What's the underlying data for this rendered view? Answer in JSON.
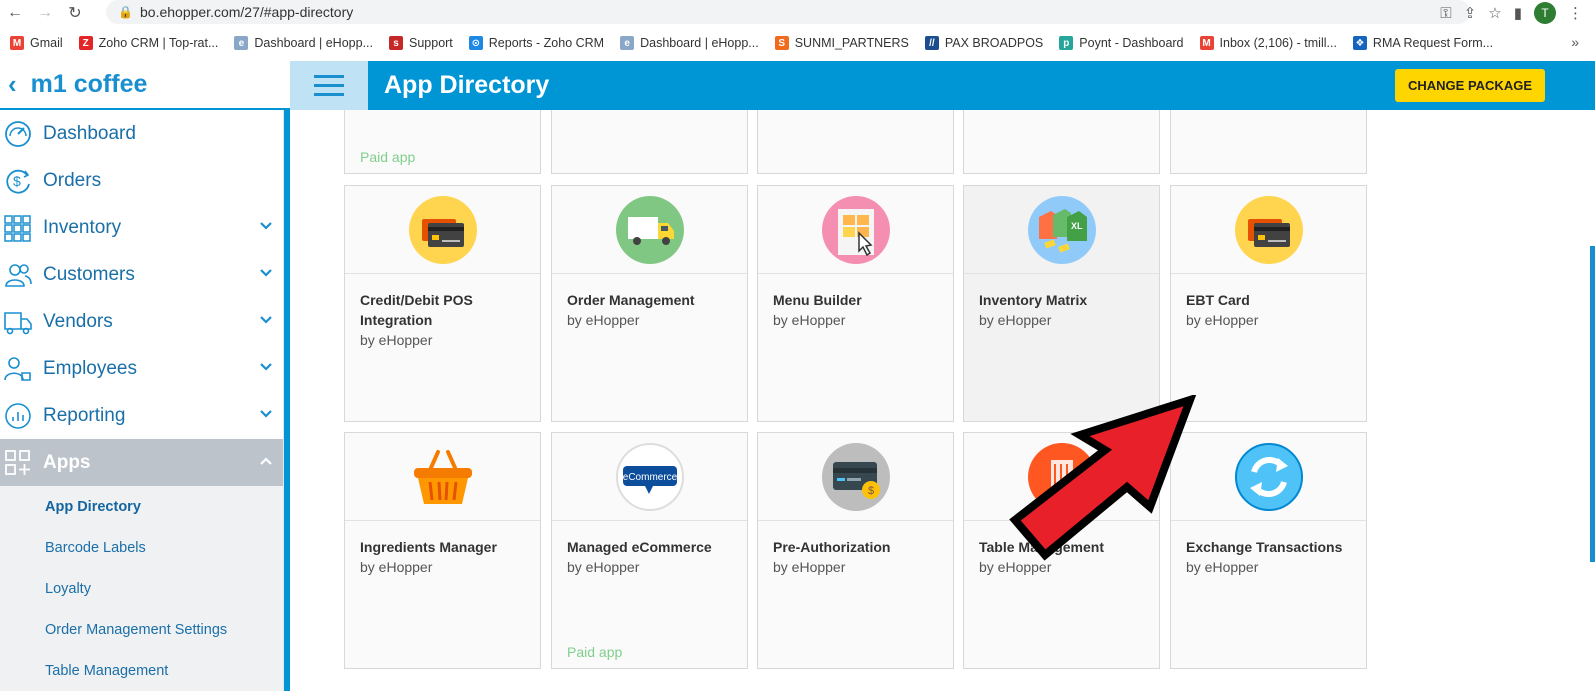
{
  "browser": {
    "url": "bo.ehopper.com/27/#app-directory",
    "profile_initial": "T",
    "bookmarks": [
      {
        "label": "Gmail",
        "color": "#ea4335",
        "glyph": "M"
      },
      {
        "label": "Zoho CRM | Top-rat...",
        "color": "#e42527",
        "glyph": "Z"
      },
      {
        "label": "Dashboard | eHopp...",
        "color": "#8aa7c7",
        "glyph": "e"
      },
      {
        "label": "Support",
        "color": "#c62828",
        "glyph": "s"
      },
      {
        "label": "Reports - Zoho CRM",
        "color": "#1e88e5",
        "glyph": "⊙"
      },
      {
        "label": "Dashboard | eHopp...",
        "color": "#8aa7c7",
        "glyph": "e"
      },
      {
        "label": "SUNMI_PARTNERS",
        "color": "#f26b1d",
        "glyph": "S"
      },
      {
        "label": "PAX BROADPOS",
        "color": "#1c4d8c",
        "glyph": "//"
      },
      {
        "label": "Poynt - Dashboard",
        "color": "#26a69a",
        "glyph": "p"
      },
      {
        "label": "Inbox (2,106) - tmill...",
        "color": "#ea4335",
        "glyph": "M"
      },
      {
        "label": "RMA Request Form...",
        "color": "#1565c0",
        "glyph": "❖"
      }
    ]
  },
  "header": {
    "store_name": "m1 coffee",
    "page_title": "App Directory",
    "change_package": "CHANGE PACKAGE"
  },
  "sidebar": {
    "items": [
      {
        "label": "Dashboard",
        "icon": "dashboard-icon",
        "has_chevron": false
      },
      {
        "label": "Orders",
        "icon": "orders-icon",
        "has_chevron": false
      },
      {
        "label": "Inventory",
        "icon": "inventory-grid-icon",
        "has_chevron": true
      },
      {
        "label": "Customers",
        "icon": "customers-icon",
        "has_chevron": true
      },
      {
        "label": "Vendors",
        "icon": "vendors-truck-icon",
        "has_chevron": true
      },
      {
        "label": "Employees",
        "icon": "employees-icon",
        "has_chevron": true
      },
      {
        "label": "Reporting",
        "icon": "reporting-icon",
        "has_chevron": true
      },
      {
        "label": "Apps",
        "icon": "apps-icon",
        "has_chevron": true
      }
    ],
    "sub_items": [
      "App Directory",
      "Barcode Labels",
      "Loyalty",
      "Order Management Settings",
      "Table Management"
    ]
  },
  "apps": {
    "top_row_partial": {
      "paid_label": "Paid app"
    },
    "row1": [
      {
        "title": "Credit/Debit POS Integration",
        "by": "by eHopper",
        "icon": "credit-card-icon"
      },
      {
        "title": "Order Management",
        "by": "by eHopper",
        "icon": "delivery-truck-icon"
      },
      {
        "title": "Menu Builder",
        "by": "by eHopper",
        "icon": "menu-builder-icon"
      },
      {
        "title": "Inventory Matrix",
        "by": "by eHopper",
        "icon": "inventory-matrix-icon"
      },
      {
        "title": "EBT Card",
        "by": "by eHopper",
        "icon": "ebt-card-icon"
      }
    ],
    "row2": [
      {
        "title": "Ingredients Manager",
        "by": "by eHopper",
        "icon": "basket-icon"
      },
      {
        "title": "Managed eCommerce",
        "by": "by eHopper",
        "icon": "ecommerce-icon",
        "paid": "Paid app"
      },
      {
        "title": "Pre-Authorization",
        "by": "by eHopper",
        "icon": "pre-auth-card-icon"
      },
      {
        "title": "Table Management",
        "by": "by eHopper",
        "icon": "table-management-icon"
      },
      {
        "title": "Exchange Transactions",
        "by": "by eHopper",
        "icon": "exchange-icon"
      }
    ]
  },
  "colors": {
    "accent": "#0096d6",
    "button": "#ffd500",
    "paid": "#7fcf8a",
    "arrow": "#e8202a"
  }
}
